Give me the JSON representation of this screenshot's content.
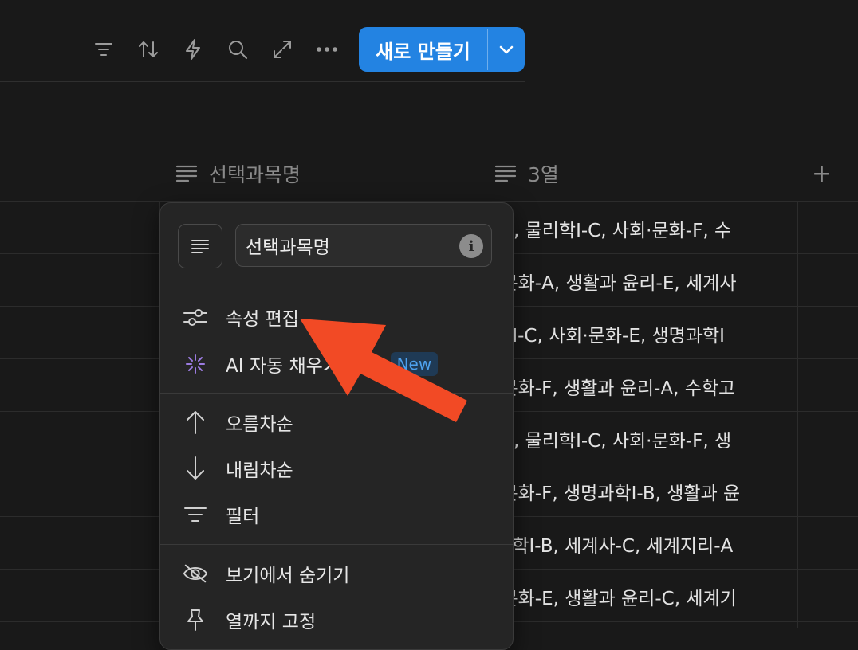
{
  "toolbar": {
    "icons": [
      "filter-icon",
      "sort-icon",
      "automation-icon",
      "search-icon",
      "expand-icon",
      "more-icon"
    ],
    "new_button_label": "새로 만들기",
    "accent": "#2383e2"
  },
  "table": {
    "columns": [
      {
        "name": "선택과목명",
        "icon": "text-lines-icon"
      },
      {
        "name": "3열",
        "icon": "text-lines-icon"
      }
    ],
    "rows": [
      "하-E, 물리학I-C, 사회·문화-F, 수",
      "회·문화-A, 생활과 윤리-E, 세계사",
      "리학I-C, 사회·문화-E, 생명과학I",
      "회·문화-F, 생활과 윤리-A, 수학고",
      "하-E, 물리학I-C, 사회·문화-F, 생",
      "회·문화-F, 생명과학I-B, 생활과 윤",
      "명과학I-B, 세계사-C, 세계지리-A",
      "회·문화-E, 생활과 윤리-C, 세계기"
    ]
  },
  "menu": {
    "property_name": "선택과목명",
    "items": {
      "edit_property": "속성 편집",
      "ai_autofill": "AI 자동 채우기 설정",
      "new_badge": "New",
      "sort_asc": "오름차순",
      "sort_desc": "내림차순",
      "filter": "필터",
      "hide_in_view": "보기에서 숨기기",
      "freeze_up_to": "열까지 고정"
    }
  },
  "colors": {
    "background": "#191919",
    "menu_bg": "#252525",
    "annotation_arrow": "#f24a25"
  }
}
